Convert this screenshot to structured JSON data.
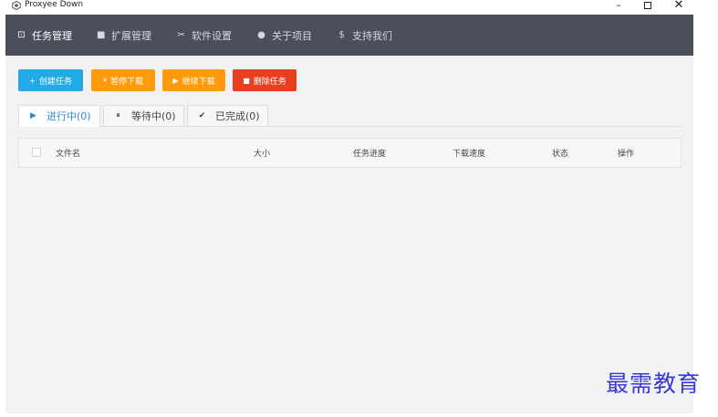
{
  "window": {
    "title": "Proxyee Down",
    "controls": {
      "minimize": "–",
      "close": "✕"
    }
  },
  "nav": {
    "items": [
      {
        "icon": "task-icon",
        "glyph": "⊡",
        "label": "任务管理",
        "active": true
      },
      {
        "icon": "extension-icon",
        "glyph": "■",
        "label": "扩展管理"
      },
      {
        "icon": "tools-icon",
        "glyph": "✂",
        "label": "软件设置"
      },
      {
        "icon": "info-icon",
        "glyph": "●",
        "label": "关于项目"
      },
      {
        "icon": "dollar-icon",
        "glyph": "$",
        "label": "支持我们"
      }
    ]
  },
  "toolbar": {
    "create": {
      "glyph": "+",
      "label": "创建任务"
    },
    "pause": {
      "glyph": "⏸",
      "label": "暂停下载"
    },
    "resume": {
      "glyph": "▶",
      "label": "继续下载"
    },
    "delete": {
      "glyph": "■",
      "label": "删除任务"
    }
  },
  "tabs": [
    {
      "glyph": "▶",
      "label": "进行中(0)",
      "active": true
    },
    {
      "glyph": "⏸",
      "label": "等待中(0)"
    },
    {
      "glyph": "✔",
      "label": "已完成(0)"
    }
  ],
  "table": {
    "columns": [
      "文件名",
      "大小",
      "任务进度",
      "下载速度",
      "状态",
      "操作"
    ]
  },
  "watermark": "最需教育",
  "colors": {
    "nav_bg": "#4b4f5c",
    "primary": "#22aae6",
    "warning": "#fe9a0b",
    "danger": "#e8401f",
    "tab_active": "#2f8ccc"
  }
}
